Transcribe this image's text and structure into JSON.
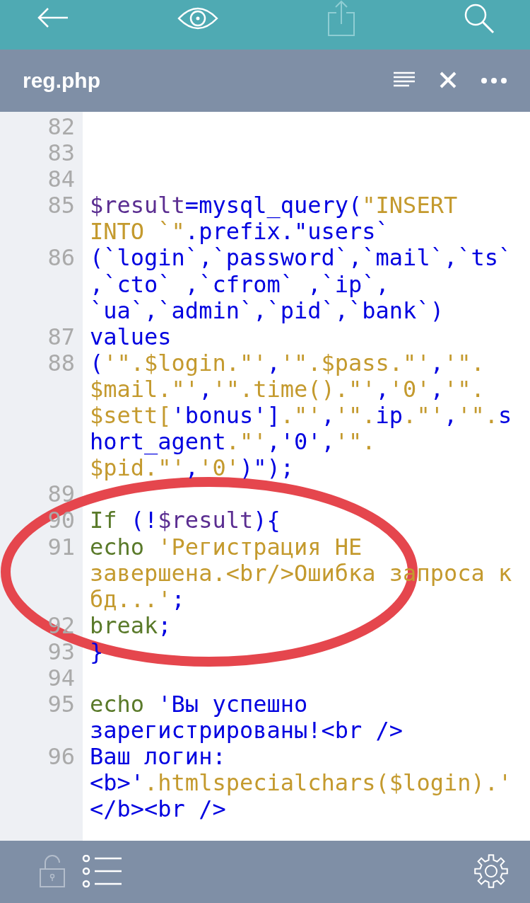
{
  "file_bar": {
    "title": "reg.php"
  },
  "code": [
    {
      "number": "82",
      "rows": [
        {
          "segments": []
        }
      ]
    },
    {
      "number": "83",
      "rows": [
        {
          "segments": []
        }
      ]
    },
    {
      "number": "84",
      "rows": [
        {
          "segments": []
        }
      ]
    },
    {
      "number": "85",
      "rows": [
        {
          "segments": [
            {
              "kind": "var",
              "text": "$result"
            },
            {
              "kind": "plain",
              "text": "=mysql_query("
            },
            {
              "kind": "string",
              "text": "\"INSERT"
            }
          ]
        },
        {
          "segments": [
            {
              "kind": "string",
              "text": "INTO `\""
            },
            {
              "kind": "plain",
              "text": ".prefix.\"users`"
            }
          ]
        }
      ]
    },
    {
      "number": "86",
      "rows": [
        {
          "segments": [
            {
              "kind": "plain",
              "text": "(`login`,`password`,`mail`,`ts`"
            }
          ]
        },
        {
          "segments": [
            {
              "kind": "plain",
              "text": ",`cto` ,`cfrom` ,`ip`,"
            }
          ]
        },
        {
          "segments": [
            {
              "kind": "plain",
              "text": "`ua`,`admin`,`pid`,`bank`)"
            }
          ]
        }
      ]
    },
    {
      "number": "87",
      "rows": [
        {
          "segments": [
            {
              "kind": "plain",
              "text": "values"
            }
          ]
        }
      ]
    },
    {
      "number": "88",
      "rows": [
        {
          "segments": [
            {
              "kind": "plain",
              "text": "("
            },
            {
              "kind": "string",
              "text": "'\".$login.\"'"
            },
            {
              "kind": "plain",
              "text": ","
            },
            {
              "kind": "string",
              "text": "'\".$pass.\"'"
            },
            {
              "kind": "plain",
              "text": ","
            },
            {
              "kind": "string",
              "text": "'\"."
            }
          ]
        },
        {
          "segments": [
            {
              "kind": "string",
              "text": "$mail.\"'"
            },
            {
              "kind": "plain",
              "text": ","
            },
            {
              "kind": "string",
              "text": "'\".time().\"'"
            },
            {
              "kind": "plain",
              "text": ","
            },
            {
              "kind": "string",
              "text": "'0'"
            },
            {
              "kind": "plain",
              "text": ","
            },
            {
              "kind": "string",
              "text": "'\"."
            }
          ]
        },
        {
          "segments": [
            {
              "kind": "string",
              "text": "$sett["
            },
            {
              "kind": "plain",
              "text": "'bonus']"
            },
            {
              "kind": "string",
              "text": ".\"'"
            },
            {
              "kind": "plain",
              "text": ","
            },
            {
              "kind": "string",
              "text": "'\"."
            },
            {
              "kind": "plain",
              "text": "ip"
            },
            {
              "kind": "string",
              "text": ".\"'"
            },
            {
              "kind": "plain",
              "text": ","
            },
            {
              "kind": "string",
              "text": "'\"."
            },
            {
              "kind": "plain",
              "text": "s"
            }
          ]
        },
        {
          "segments": [
            {
              "kind": "plain",
              "text": "hort_agent"
            },
            {
              "kind": "string",
              "text": ".\"'"
            },
            {
              "kind": "plain",
              "text": ",'0',"
            },
            {
              "kind": "string",
              "text": "'\"."
            }
          ]
        },
        {
          "segments": [
            {
              "kind": "string",
              "text": "$pid.\"'"
            },
            {
              "kind": "plain",
              "text": ","
            },
            {
              "kind": "string",
              "text": "'0'"
            },
            {
              "kind": "plain",
              "text": ")\");"
            }
          ]
        }
      ]
    },
    {
      "number": "89",
      "rows": [
        {
          "segments": []
        }
      ]
    },
    {
      "number": "90",
      "rows": [
        {
          "segments": [
            {
              "kind": "keyword",
              "text": "If"
            },
            {
              "kind": "plain",
              "text": " (!"
            },
            {
              "kind": "var",
              "text": "$result"
            },
            {
              "kind": "plain",
              "text": "){"
            }
          ]
        }
      ]
    },
    {
      "number": "91",
      "rows": [
        {
          "segments": [
            {
              "kind": "keyword",
              "text": "echo"
            },
            {
              "kind": "string",
              "text": " 'Регистрация НЕ"
            }
          ]
        },
        {
          "segments": [
            {
              "kind": "string",
              "text": "завершена.<br/>Ошибка запроса к"
            }
          ]
        },
        {
          "segments": [
            {
              "kind": "string",
              "text": "бд...'"
            },
            {
              "kind": "plain",
              "text": ";"
            }
          ]
        }
      ]
    },
    {
      "number": "92",
      "rows": [
        {
          "segments": [
            {
              "kind": "keyword",
              "text": "break"
            },
            {
              "kind": "plain",
              "text": ";"
            }
          ]
        }
      ]
    },
    {
      "number": "93",
      "rows": [
        {
          "segments": [
            {
              "kind": "plain",
              "text": "}"
            }
          ]
        }
      ]
    },
    {
      "number": "94",
      "rows": [
        {
          "segments": []
        }
      ]
    },
    {
      "number": "95",
      "rows": [
        {
          "segments": [
            {
              "kind": "keyword",
              "text": "echo"
            },
            {
              "kind": "plain",
              "text": " 'Вы успешно"
            }
          ]
        },
        {
          "segments": [
            {
              "kind": "plain",
              "text": "зарегистрированы!<br />"
            }
          ]
        }
      ]
    },
    {
      "number": "96",
      "rows": [
        {
          "segments": [
            {
              "kind": "plain",
              "text": "Ваш логин:"
            }
          ]
        },
        {
          "segments": [
            {
              "kind": "plain",
              "text": "<b>'"
            },
            {
              "kind": "string",
              "text": ".htmlspecialchars($login).'"
            }
          ]
        },
        {
          "segments": [
            {
              "kind": "plain",
              "text": "</b><br />"
            }
          ]
        }
      ]
    }
  ]
}
